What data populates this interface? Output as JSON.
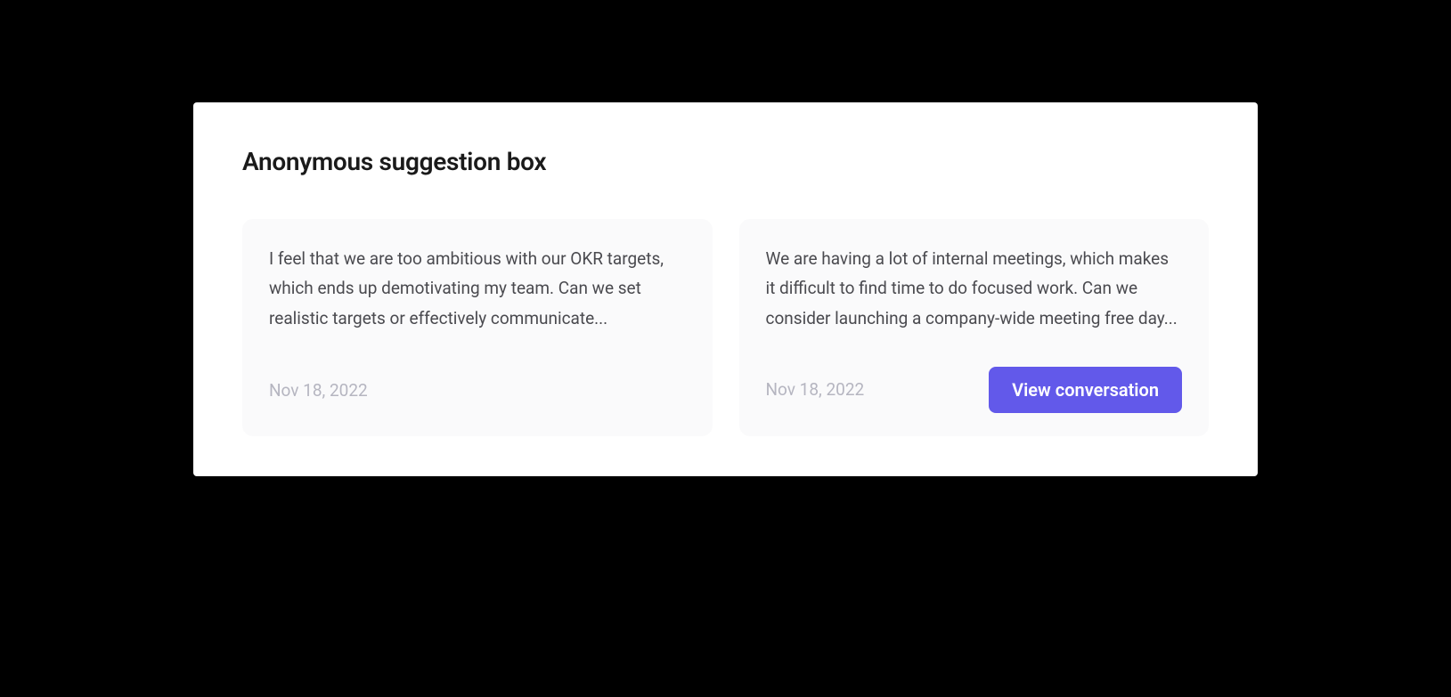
{
  "panel": {
    "title": "Anonymous suggestion box"
  },
  "suggestions": [
    {
      "text": "I feel that we are too ambitious with our OKR targets, which ends up demotivating my team. Can we set realistic targets or effectively communicate...",
      "date": "Nov 18, 2022",
      "showButton": false
    },
    {
      "text": "We are having a lot of internal meetings, which makes it difficult to find time to do focused work. Can we consider launching a company-wide meeting free day...",
      "date": "Nov 18, 2022",
      "showButton": true
    }
  ],
  "actions": {
    "viewConversationLabel": "View conversation"
  }
}
